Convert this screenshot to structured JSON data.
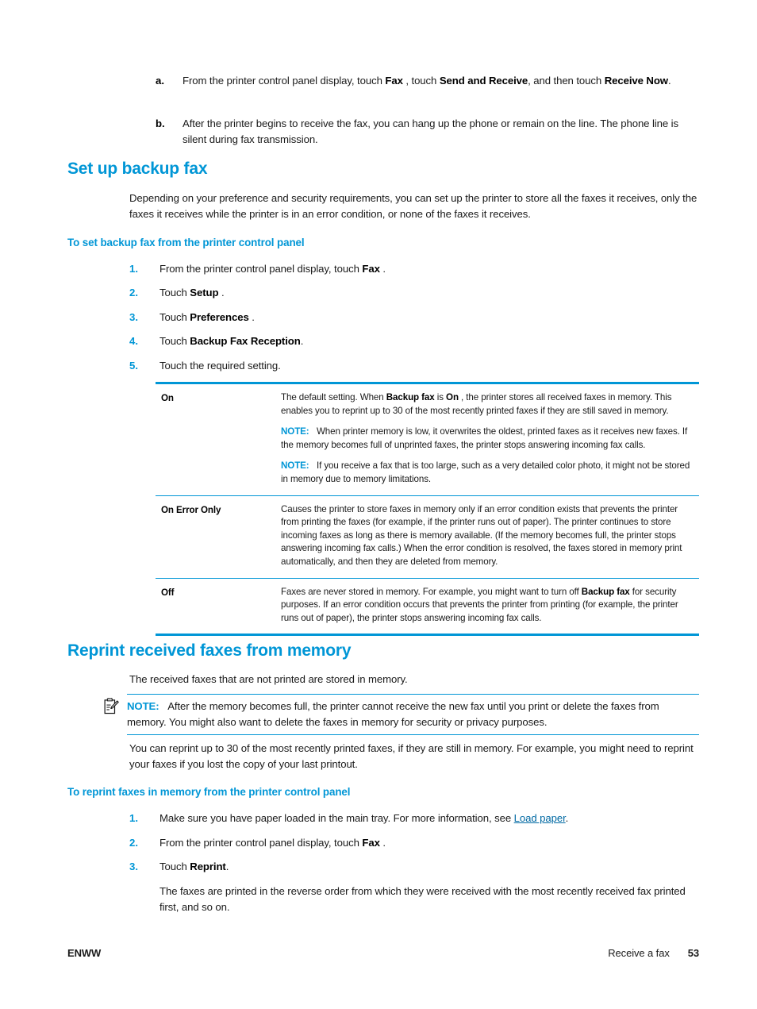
{
  "page": {
    "footer_left": "ENWW",
    "footer_section": "Receive a fax",
    "footer_page_number": "53",
    "accent_color": "#0096D6",
    "link_color": "#0069A3"
  },
  "top_substeps": {
    "items": [
      {
        "marker": "a.",
        "segments": [
          {
            "text": "From the printer control panel display, touch ",
            "bold": false
          },
          {
            "text": "Fax",
            "bold": true
          },
          {
            "text": " , touch ",
            "bold": false
          },
          {
            "text": "Send and Receive",
            "bold": true
          },
          {
            "text": ", and then touch ",
            "bold": false
          },
          {
            "text": "Receive Now",
            "bold": true
          },
          {
            "text": ".",
            "bold": false
          }
        ]
      },
      {
        "marker": "b.",
        "segments": [
          {
            "text": "After the printer begins to receive the fax, you can hang up the phone or remain on the line. The phone line is silent during fax transmission.",
            "bold": false
          }
        ]
      }
    ]
  },
  "section_backup": {
    "heading": "Set up backup fax",
    "intro": "Depending on your preference and security requirements, you can set up the printer to store all the faxes it receives, only the faxes it receives while the printer is in an error condition, or none of the faxes it receives.",
    "subheading": "To set backup fax from the printer control panel",
    "steps": [
      {
        "marker": "1.",
        "segments": [
          {
            "text": "From the printer control panel display, touch ",
            "bold": false
          },
          {
            "text": "Fax",
            "bold": true
          },
          {
            "text": " .",
            "bold": false
          }
        ]
      },
      {
        "marker": "2.",
        "segments": [
          {
            "text": "Touch ",
            "bold": false
          },
          {
            "text": "Setup",
            "bold": true
          },
          {
            "text": " .",
            "bold": false
          }
        ]
      },
      {
        "marker": "3.",
        "segments": [
          {
            "text": "Touch ",
            "bold": false
          },
          {
            "text": "Preferences",
            "bold": true
          },
          {
            "text": " .",
            "bold": false
          }
        ]
      },
      {
        "marker": "4.",
        "segments": [
          {
            "text": "Touch ",
            "bold": false
          },
          {
            "text": "Backup Fax Reception",
            "bold": true
          },
          {
            "text": ".",
            "bold": false
          }
        ]
      },
      {
        "marker": "5.",
        "segments": [
          {
            "text": "Touch the required setting.",
            "bold": false
          }
        ]
      }
    ],
    "settings_table": {
      "rows": [
        {
          "key": "On",
          "paragraphs": [
            {
              "note": null,
              "segments": [
                {
                  "text": "The default setting. When ",
                  "bold": false
                },
                {
                  "text": "Backup fax",
                  "bold": true
                },
                {
                  "text": " is ",
                  "bold": false
                },
                {
                  "text": "On",
                  "bold": true
                },
                {
                  "text": " , the printer stores all received faxes in memory. This enables you to reprint up to 30 of the most recently printed faxes if they are still saved in memory.",
                  "bold": false
                }
              ]
            },
            {
              "note": "NOTE:",
              "segments": [
                {
                  "text": "When printer memory is low, it overwrites the oldest, printed faxes as it receives new faxes. If the memory becomes full of unprinted faxes, the printer stops answering incoming fax calls.",
                  "bold": false
                }
              ]
            },
            {
              "note": "NOTE:",
              "segments": [
                {
                  "text": "If you receive a fax that is too large, such as a very detailed color photo, it might not be stored in memory due to memory limitations.",
                  "bold": false
                }
              ]
            }
          ]
        },
        {
          "key": "On Error Only",
          "paragraphs": [
            {
              "note": null,
              "segments": [
                {
                  "text": "Causes the printer to store faxes in memory only if an error condition exists that prevents the printer from printing the faxes (for example, if the printer runs out of paper). The printer continues to store incoming faxes as long as there is memory available. (If the memory becomes full, the printer stops answering incoming fax calls.) When the error condition is resolved, the faxes stored in memory print automatically, and then they are deleted from memory.",
                  "bold": false
                }
              ]
            }
          ]
        },
        {
          "key": "Off",
          "paragraphs": [
            {
              "note": null,
              "segments": [
                {
                  "text": "Faxes are never stored in memory. For example, you might want to turn off ",
                  "bold": false
                },
                {
                  "text": "Backup fax",
                  "bold": true
                },
                {
                  "text": " for security purposes. If an error condition occurs that prevents the printer from printing (for example, the printer runs out of paper), the printer stops answering incoming fax calls.",
                  "bold": false
                }
              ]
            }
          ]
        }
      ]
    }
  },
  "section_reprint": {
    "heading": "Reprint received faxes from memory",
    "intro": "The received faxes that are not printed are stored in memory.",
    "note": {
      "icon": "note-clipboard-icon",
      "label": "NOTE:",
      "text": "After the memory becomes full, the printer cannot receive the new fax until you print or delete the faxes from memory. You might also want to delete the faxes in memory for security or privacy purposes."
    },
    "body": "You can reprint up to 30 of the most recently printed faxes, if they are still in memory. For example, you might need to reprint your faxes if you lost the copy of your last printout.",
    "subheading": "To reprint faxes in memory from the printer control panel",
    "steps": [
      {
        "marker": "1.",
        "segments": [
          {
            "text": "Make sure you have paper loaded in the main tray. For more information, see ",
            "bold": false
          },
          {
            "text": "Load paper",
            "bold": false,
            "link": true
          },
          {
            "text": ".",
            "bold": false
          }
        ]
      },
      {
        "marker": "2.",
        "segments": [
          {
            "text": "From the printer control panel display, touch ",
            "bold": false
          },
          {
            "text": "Fax",
            "bold": true
          },
          {
            "text": " .",
            "bold": false
          }
        ]
      },
      {
        "marker": "3.",
        "segments": [
          {
            "text": "Touch ",
            "bold": false
          },
          {
            "text": "Reprint",
            "bold": true
          },
          {
            "text": ".",
            "bold": false
          }
        ]
      }
    ],
    "closing": "The faxes are printed in the reverse order from which they were received with the most recently received fax printed first, and so on."
  }
}
